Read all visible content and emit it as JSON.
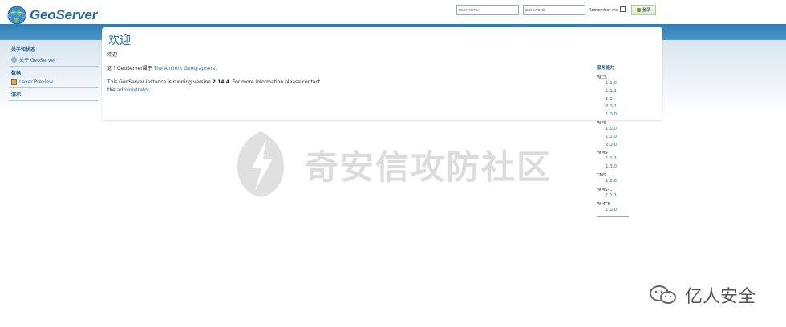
{
  "header": {
    "logo_text": "GeoServer",
    "username_placeholder": "username",
    "password_placeholder": "password",
    "remember_label": "Remember me",
    "login_label": "登录"
  },
  "sidebar": {
    "sections": [
      {
        "title": "关于和状态",
        "items": [
          {
            "label": "关于 GeoServer",
            "icon": "info-icon"
          }
        ]
      },
      {
        "title": "数据",
        "items": [
          {
            "label": "Layer Preview",
            "icon": "layer-preview-icon"
          }
        ]
      },
      {
        "title": "演示",
        "items": []
      }
    ]
  },
  "main": {
    "title": "欢迎",
    "subtitle": "欢迎",
    "intro_prefix": "这个GeoServer属于",
    "intro_link": "The Ancient Geographers",
    "intro_suffix": ".",
    "version_prefix": "This GeoServer instance is running version",
    "version": "2.14.4",
    "version_suffix": ". For more information please contact",
    "contact_prefix": "the",
    "contact_link": "administrator",
    "contact_suffix": "."
  },
  "capabilities": {
    "title": "服务能力",
    "services": [
      {
        "name": "WCS",
        "versions": [
          "1.1.0",
          "1.1.1",
          "1.1",
          "2.0.1",
          "1.0.0"
        ]
      },
      {
        "name": "WFS",
        "versions": [
          "1.0.0",
          "1.1.0",
          "2.0.0"
        ]
      },
      {
        "name": "WMS",
        "versions": [
          "1.1.1",
          "1.3.0"
        ]
      },
      {
        "name": "TMS",
        "versions": [
          "1.0.0"
        ]
      },
      {
        "name": "WMS-C",
        "versions": [
          "1.1.1"
        ]
      },
      {
        "name": "WMTS",
        "versions": [
          "1.0.0"
        ]
      }
    ]
  },
  "watermark": {
    "text": "奇安信攻防社区"
  },
  "brand": {
    "text": "亿人安全"
  },
  "colors": {
    "header_band": "#2f7eb5",
    "link": "#1b6fb1",
    "title": "#1b6fb1"
  }
}
